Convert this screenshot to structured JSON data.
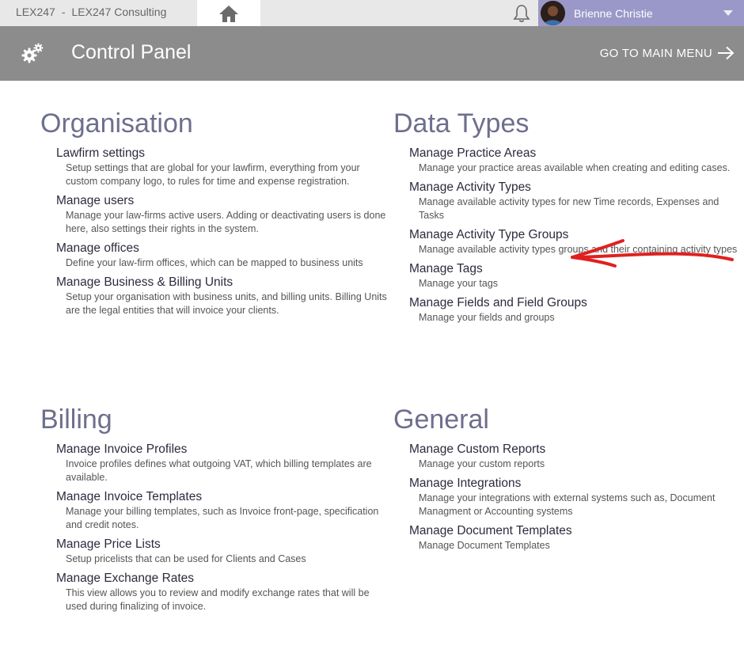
{
  "topbar": {
    "brand_short": "LEX247",
    "brand_separator": "-",
    "brand_name": "LEX247 Consulting",
    "user_name": "Brienne Christie",
    "icons": {
      "home": "home-icon",
      "notifications": "bell-icon",
      "dropdown": "chevron-down-icon"
    }
  },
  "header": {
    "title": "Control Panel",
    "main_menu_label": "GO TO MAIN MENU",
    "icons": {
      "settings": "gears-icon",
      "arrow": "arrow-right-icon"
    }
  },
  "sections": {
    "organisation": {
      "title": "Organisation",
      "items": [
        {
          "title": "Lawfirm settings",
          "desc": "Setup settings that are global for your lawfirm, everything from your custom company logo, to rules for time and expense registration."
        },
        {
          "title": "Manage users",
          "desc": "Manage your law-firms active users. Adding or deactivating users is done here, also settings their rights in the system."
        },
        {
          "title": "Manage offices",
          "desc": "Define your law-firm offices, which can be mapped to business units"
        },
        {
          "title": "Manage Business & Billing Units",
          "desc": "Setup your organisation with business units, and billing units. Billing Units are the legal entities that will invoice your clients."
        }
      ]
    },
    "data_types": {
      "title": "Data Types",
      "items": [
        {
          "title": "Manage Practice Areas",
          "desc": "Manage your practice areas available when creating and editing cases."
        },
        {
          "title": "Manage Activity Types",
          "desc": "Manage available activity types for new Time records, Expenses and Tasks"
        },
        {
          "title": "Manage Activity Type Groups",
          "desc": "Manage available activity types groups and their containing activity types"
        },
        {
          "title": "Manage Tags",
          "desc": "Manage your tags"
        },
        {
          "title": "Manage Fields and Field Groups",
          "desc": "Manage your fields and groups"
        }
      ]
    },
    "billing": {
      "title": "Billing",
      "items": [
        {
          "title": "Manage Invoice Profiles",
          "desc": "Invoice profiles defines what outgoing VAT, which billing templates are available."
        },
        {
          "title": "Manage Invoice Templates",
          "desc": "Manage your billing templates, such as Invoice front-page, specification and credit notes."
        },
        {
          "title": "Manage Price Lists",
          "desc": "Setup pricelists that can be used for Clients and Cases"
        },
        {
          "title": "Manage Exchange Rates",
          "desc": "This view allows you to review and modify exchange rates that will be used during finalizing of invoice."
        }
      ]
    },
    "general": {
      "title": "General",
      "items": [
        {
          "title": "Manage Custom Reports",
          "desc": "Manage your custom reports"
        },
        {
          "title": "Manage Integrations",
          "desc": "Manage your integrations with external systems such as, Document Managment or Accounting systems"
        },
        {
          "title": "Manage Document Templates",
          "desc": "Manage Document Templates"
        }
      ]
    }
  },
  "annotation": {
    "arrow_color": "#e02020"
  }
}
